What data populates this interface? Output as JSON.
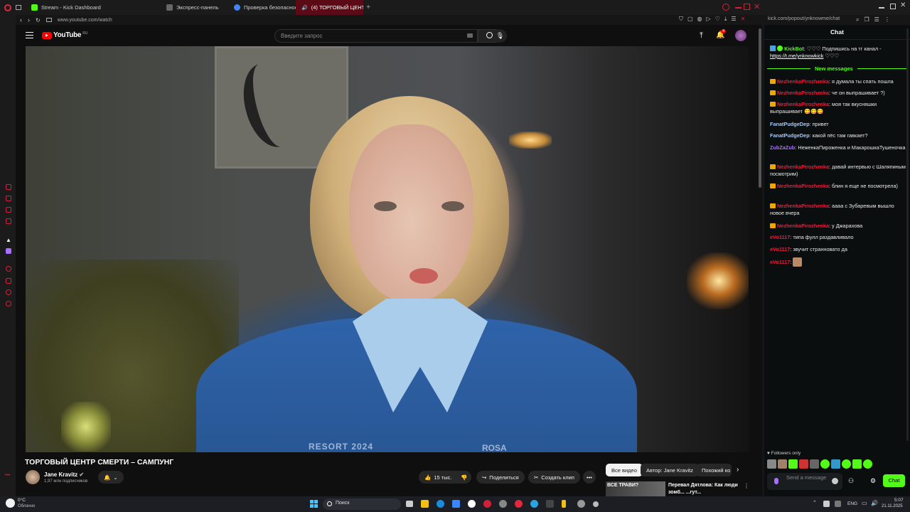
{
  "browser": {
    "tabs": [
      {
        "label": "Stream - Kick Dashboard",
        "icon": "kick-icon",
        "color": "#53fc18"
      },
      {
        "label": "Экспресс-панель",
        "icon": "speed-dial-icon",
        "color": "#888888"
      },
      {
        "label": "Проверка безопасности",
        "icon": "google-icon",
        "color": "#4285f4"
      },
      {
        "label": "(4) ТОРГОВЫЙ ЦЕНТ",
        "icon": "youtube-icon",
        "color": "#ff0000"
      }
    ],
    "new_tab": "+",
    "url": "www.youtube.com/watch",
    "popout_url": "kick.com/popout/ynknowme/chat"
  },
  "youtube": {
    "logo": "YouTube",
    "region": "RU",
    "search_placeholder": "Введите запрос",
    "notif_count": "4",
    "video_title": "ТОРГОВЫЙ ЦЕНТР СМЕРТИ – САМПУНГ",
    "video_overlay": {
      "text1": "RESORT 2024",
      "text2": "ROSA"
    },
    "channel": {
      "name": "Jane Kravitz",
      "subs": "1,97 млн подписчиков"
    },
    "actions": {
      "likes": "15 тыс.",
      "share": "Поделиться",
      "clip": "Создать клип"
    },
    "chips": [
      "Все видео",
      "Автор: Jane Kravitz",
      "Похожий ко"
    ],
    "suggestion": {
      "thumb_text": "ВСЕ ТРАВИ?",
      "title": "Перевал Дятлова: Как люди",
      "title2": "зомб... ...гут..."
    }
  },
  "chat": {
    "header": "Chat",
    "pinned": {
      "user": "KickBot",
      "text": ": ♡♡♡ Подпишись на тг канал -",
      "link": "https://t.me/ynknowkick",
      "hearts": "♡♡♡"
    },
    "divider": "New messages",
    "messages": [
      {
        "user": "NezhenkaPirozhenka",
        "text": ": я думала ты спать пошла",
        "color": "#e91e3c",
        "badge": true
      },
      {
        "user": "NezhenkaPirozhenka",
        "text": ": че он выпрашивает ?)",
        "color": "#e91e3c",
        "badge": true
      },
      {
        "user": "NezhenkaPirozhenka",
        "text": ": моя так вкусняшки выпрашивает 😋😋😋",
        "color": "#e91e3c",
        "badge": true
      },
      {
        "user": "FanatPudgeDep",
        "text": ": привет",
        "color": "#a9c7f0",
        "badge": false
      },
      {
        "user": "FanatPudgeDep",
        "text": ": какой пёс там гавкает?",
        "color": "#a9c7f0",
        "badge": false
      },
      {
        "user": "ZubZaZub",
        "text": ": НеженкаПироженка и МакарошкаТушеночка",
        "color": "#a970ff",
        "badge": false
      },
      {
        "user": "NezhenkaPirozhenka",
        "text": ": давай интервью с Шаляпиным посмотрим)",
        "color": "#e91e3c",
        "badge": true
      },
      {
        "user": "NezhenkaPirozhenka",
        "text": ": блин я еще не посмотрела)",
        "color": "#e91e3c",
        "badge": true
      },
      {
        "user": "NezhenkaPirozhenka",
        "text": ": аааа с Зубаревым вышло новое вчера",
        "color": "#e91e3c",
        "badge": true
      },
      {
        "user": "NezhenkaPirozhenka",
        "text": ": у Джарахова",
        "color": "#e91e3c",
        "badge": true
      },
      {
        "user": "eVo1117",
        "text": ": типа фулл раздавливало",
        "color": "#e91e3c",
        "badge": false
      },
      {
        "user": "eVo1117",
        "text": ": звучит странновато да",
        "color": "#e91e3c",
        "badge": false
      },
      {
        "user": "eVo1117",
        "text": ":",
        "color": "#e91e3c",
        "badge": false
      }
    ],
    "followers_only": "Followers only",
    "input_placeholder": "Send a message",
    "send_label": "Chat",
    "accent": "#53fc18"
  },
  "taskbar": {
    "weather_temp": "0°C",
    "weather_text": "Облачно",
    "search": "Поиск",
    "lang": "ENG",
    "time": "5:07",
    "date": "21.11.2025"
  }
}
